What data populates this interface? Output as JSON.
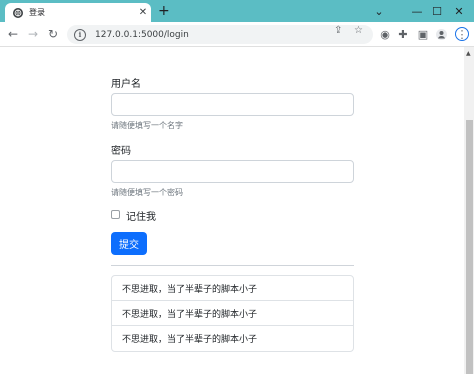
{
  "browser": {
    "tab_title": "登录",
    "url": "127.0.0.1:5000/login"
  },
  "form": {
    "username_label": "用户名",
    "username_value": "",
    "username_help": "请随便填写一个名字",
    "password_label": "密码",
    "password_value": "",
    "password_help": "请随便填写一个密码",
    "remember_label": "记住我",
    "remember_checked": false,
    "submit_label": "提交"
  },
  "list": {
    "items": [
      "不思进取，当了半辈子的脚本小子",
      "不思进取，当了半辈子的脚本小子",
      "不思进取，当了半辈子的脚本小子"
    ]
  },
  "colors": {
    "tabbar": "#5bbdc4",
    "primary_button": "#0d6efd"
  }
}
